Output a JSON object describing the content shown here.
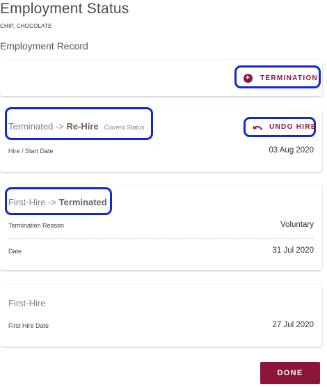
{
  "page": {
    "title": "Employment Status",
    "subject_name": "CHIP, CHOCOLATE",
    "section_title": "Employment Record"
  },
  "actions": {
    "termination_label": "TERMINATION"
  },
  "records": {
    "rehire": {
      "from": "Terminated",
      "arrow": "->",
      "to": "Re-Hire",
      "current_status": "Current Status",
      "undo_label": "UNDO HIRE",
      "fields": [
        {
          "label": "Hire / Start Date",
          "value": "03 Aug 2020"
        }
      ]
    },
    "terminated": {
      "from": "First-Hire",
      "arrow": "->",
      "to": "Terminated",
      "fields": [
        {
          "label": "Termination Reason",
          "value": "Voluntary"
        },
        {
          "label": "Date",
          "value": "31 Jul 2020"
        }
      ]
    },
    "first_hire": {
      "title": "First-Hire",
      "fields": [
        {
          "label": "First Hire Date",
          "value": "27 Jul 2020"
        }
      ]
    }
  },
  "footer": {
    "done_label": "DONE"
  },
  "colors": {
    "accent": "#8b1538",
    "highlight_outline": "#1226d8",
    "entry_title": "#8a7f76"
  },
  "icons": {
    "termination": "plus-circle-icon",
    "undo_hire": "undo-arrow-icon"
  }
}
